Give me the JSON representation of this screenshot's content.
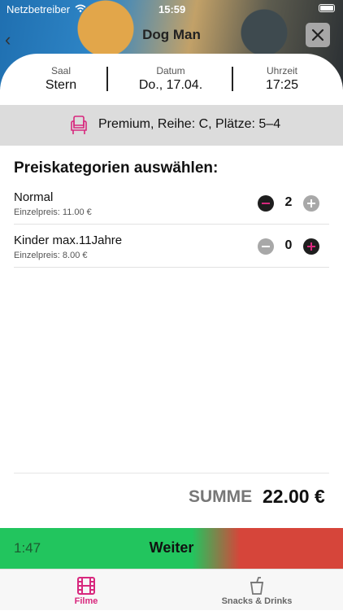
{
  "status_bar": {
    "carrier": "Netzbetreiber",
    "time": "15:59"
  },
  "header": {
    "movie_title": "Dog Man"
  },
  "info": {
    "saal_label": "Saal",
    "saal_value": "Stern",
    "datum_label": "Datum",
    "datum_value": "Do., 17.04.",
    "uhrzeit_label": "Uhrzeit",
    "uhrzeit_value": "17:25"
  },
  "seats": {
    "text": "Premium, Reihe: C, Plätze: 5–4"
  },
  "price_section": {
    "heading": "Preiskategorien auswählen:",
    "categories": [
      {
        "name": "Normal",
        "price": "Einzelpreis: 11.00 €",
        "quantity": "2"
      },
      {
        "name": "Kinder max.11Jahre",
        "price": "Einzelpreis: 8.00 €",
        "quantity": "0"
      }
    ]
  },
  "summary": {
    "label": "SUMME",
    "value": "22.00 €"
  },
  "action": {
    "timer": "1:47",
    "label": "Weiter"
  },
  "tabs": [
    {
      "label": "Filme",
      "icon": "film-icon",
      "active": true
    },
    {
      "label": "Snacks & Drinks",
      "icon": "cup-icon",
      "active": false
    }
  ],
  "colors": {
    "accent": "#d8287e",
    "go": "#22c55e",
    "stop": "#d6453a"
  }
}
